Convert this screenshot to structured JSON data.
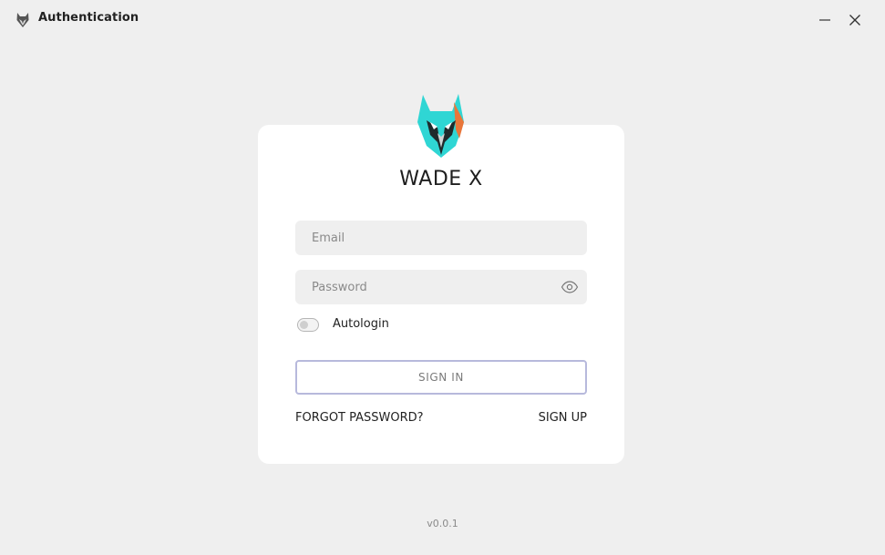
{
  "window": {
    "title": "Authentication",
    "minimize_icon": "minimize-icon",
    "close_icon": "close-icon"
  },
  "brand": {
    "name": "WADE X",
    "logo_icon": "wolf-logo-icon"
  },
  "form": {
    "email_placeholder": "Email",
    "password_placeholder": "Password",
    "autologin_label": "Autologin",
    "autologin_enabled": false,
    "signin_label": "SIGN IN",
    "forgot_label": "FORGOT PASSWORD?",
    "signup_label": "SIGN UP"
  },
  "footer": {
    "version": "v0.0.1"
  },
  "colors": {
    "accent_teal": "#2fd6d4",
    "signin_border": "#b7b9dc",
    "background": "#efefef",
    "card": "#ffffff"
  }
}
